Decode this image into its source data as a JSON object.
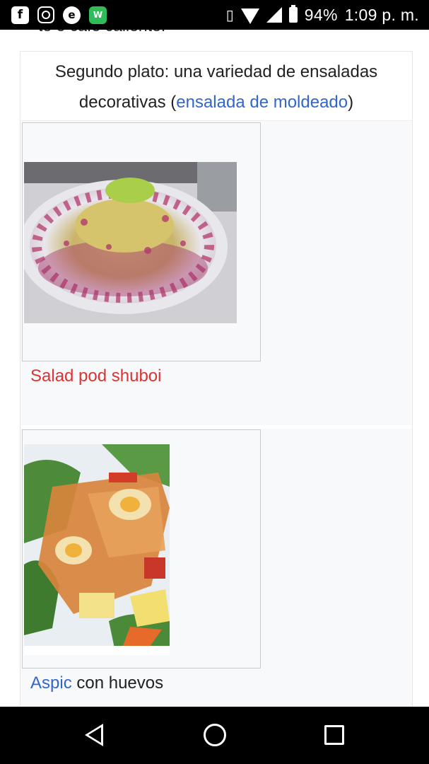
{
  "status_bar": {
    "battery": "94%",
    "time": "1:09 p. m.",
    "apps": [
      "facebook-icon",
      "instagram-icon",
      "e-app-icon",
      "webtoon-icon"
    ]
  },
  "page": {
    "previous_line": "te o café caliente.",
    "caption_prefix": "Segundo plato: una variedad de ensaladas decorativas (",
    "caption_link": "ensalada de moldeado",
    "caption_suffix": ")",
    "items": [
      {
        "label_link": "Salad pod shuboi",
        "label_text": ""
      },
      {
        "label_link": "Aspic",
        "label_text": " con huevos"
      }
    ]
  },
  "colors": {
    "link_blue": "#3366cc",
    "link_red": "#dd3333",
    "text": "#202122"
  }
}
